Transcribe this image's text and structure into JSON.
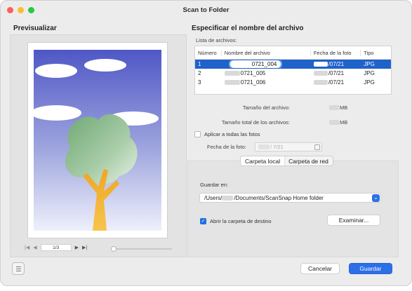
{
  "window": {
    "title": "Scan to Folder"
  },
  "preview": {
    "heading": "Previsualizar",
    "page_indicator": "1/3",
    "zoom_level": 0.0
  },
  "file_name": {
    "heading": "Especificar el nombre del archivo",
    "list_label": "Lista de archivos:",
    "columns": [
      "Número",
      "Nombre del archivo",
      "Fecha de la foto",
      "Tipo"
    ],
    "rows": [
      {
        "num": "1",
        "name": "0721_004",
        "date": "/07/21",
        "type": "JPG",
        "selected": true
      },
      {
        "num": "2",
        "name": "0721_005",
        "date": "/07/21",
        "type": "JPG",
        "selected": false
      },
      {
        "num": "3",
        "name": "0721_006",
        "date": "/07/21",
        "type": "JPG",
        "selected": false
      }
    ],
    "file_size_label": "Tamaño del archivo:",
    "file_size_unit": "MB",
    "total_size_label": "Tamaño total de los archivos:",
    "total_size_unit": "MB",
    "apply_all_label": "Aplicar a todas las fotos",
    "photo_date_label": "Fecha de la foto:",
    "photo_date_value": "/ 7/21"
  },
  "destination": {
    "tabs": [
      "Carpeta local",
      "Carpeta de red"
    ],
    "active_tab": 0,
    "save_in_label": "Guardar en:",
    "path_prefix": "/Users/",
    "path_suffix": "/Documents/ScanSnap Home folder",
    "open_folder_label": "Abrir la carpeta de destino",
    "open_folder_checked": true,
    "browse_label": "Examinar..."
  },
  "footer": {
    "cancel_label": "Cancelar",
    "save_label": "Guardar"
  },
  "colors": {
    "accent": "#2c6fe6",
    "selection": "#1f62c9",
    "close": "#ff5f57",
    "minimize": "#febc2e",
    "zoom": "#28c840"
  }
}
